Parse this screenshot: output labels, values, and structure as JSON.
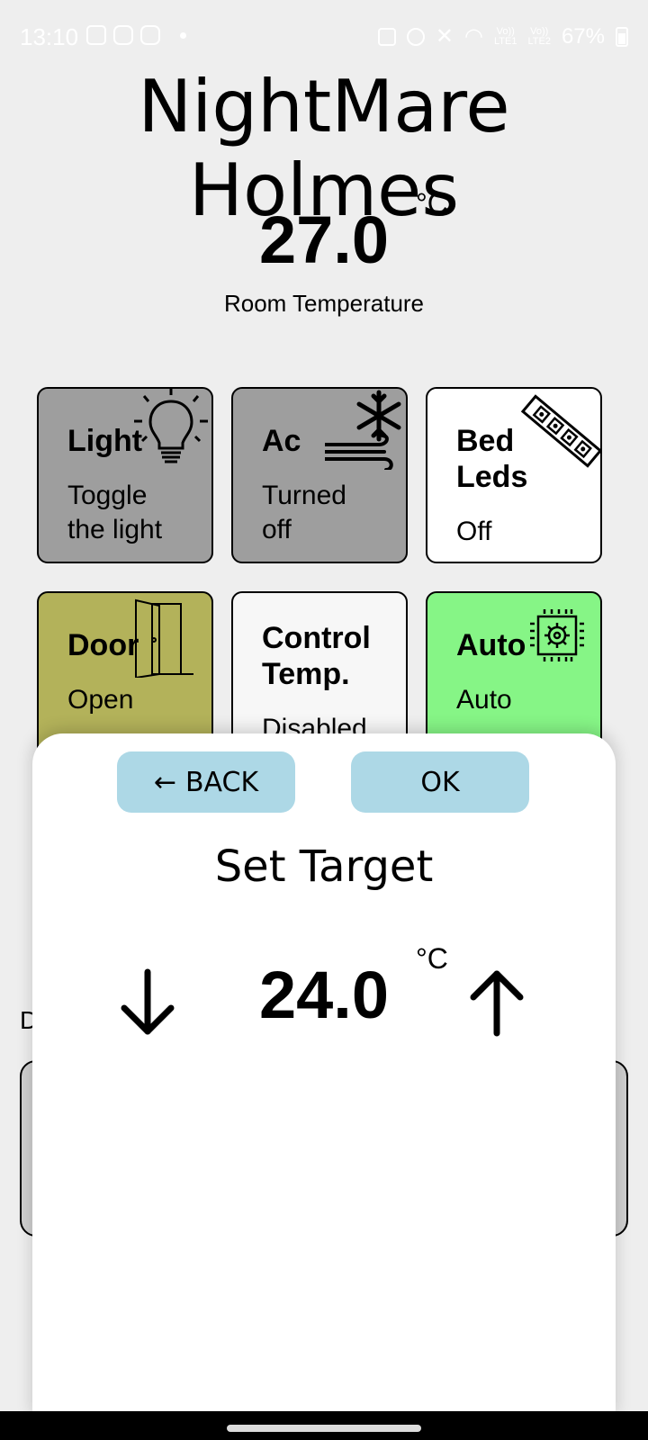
{
  "status_bar": {
    "time": "13:10",
    "battery": "67%",
    "sim1": "Vo))\nLTE1",
    "sim2": "Vo))\nLTE2"
  },
  "app": {
    "title": "NightMare Holmes"
  },
  "room": {
    "temperature": "27.0",
    "unit": "°C",
    "label": "Room Temperature"
  },
  "tiles": [
    {
      "title": "Light",
      "subtitle": "Toggle\nthe light",
      "icon": "lightbulb-icon",
      "bg": "#9e9e9e"
    },
    {
      "title": "Ac",
      "subtitle": "Turned\noff",
      "icon": "snowflake-wind-icon",
      "bg": "#9e9e9e"
    },
    {
      "title": "Bed\nLeds",
      "subtitle": "Off",
      "icon": "led-strip-icon",
      "bg": "#ffffff"
    },
    {
      "title": "Door",
      "subtitle": "Open",
      "icon": "door-icon",
      "bg": "#b3b25a"
    },
    {
      "title": "Control\nTemp.",
      "subtitle": "Disabled",
      "icon": "",
      "bg": "#f7f7f7"
    },
    {
      "title": "Auto",
      "subtitle": "Auto",
      "icon": "chip-gear-icon",
      "bg": "#86f586"
    }
  ],
  "behind": {
    "label": "D"
  },
  "sheet": {
    "back_label": "BACK",
    "ok_label": "OK",
    "title": "Set Target",
    "target_value": "24.0",
    "unit": "°C",
    "down_icon": "arrow-down-icon",
    "up_icon": "arrow-up-icon",
    "button_color": "#add8e6"
  }
}
